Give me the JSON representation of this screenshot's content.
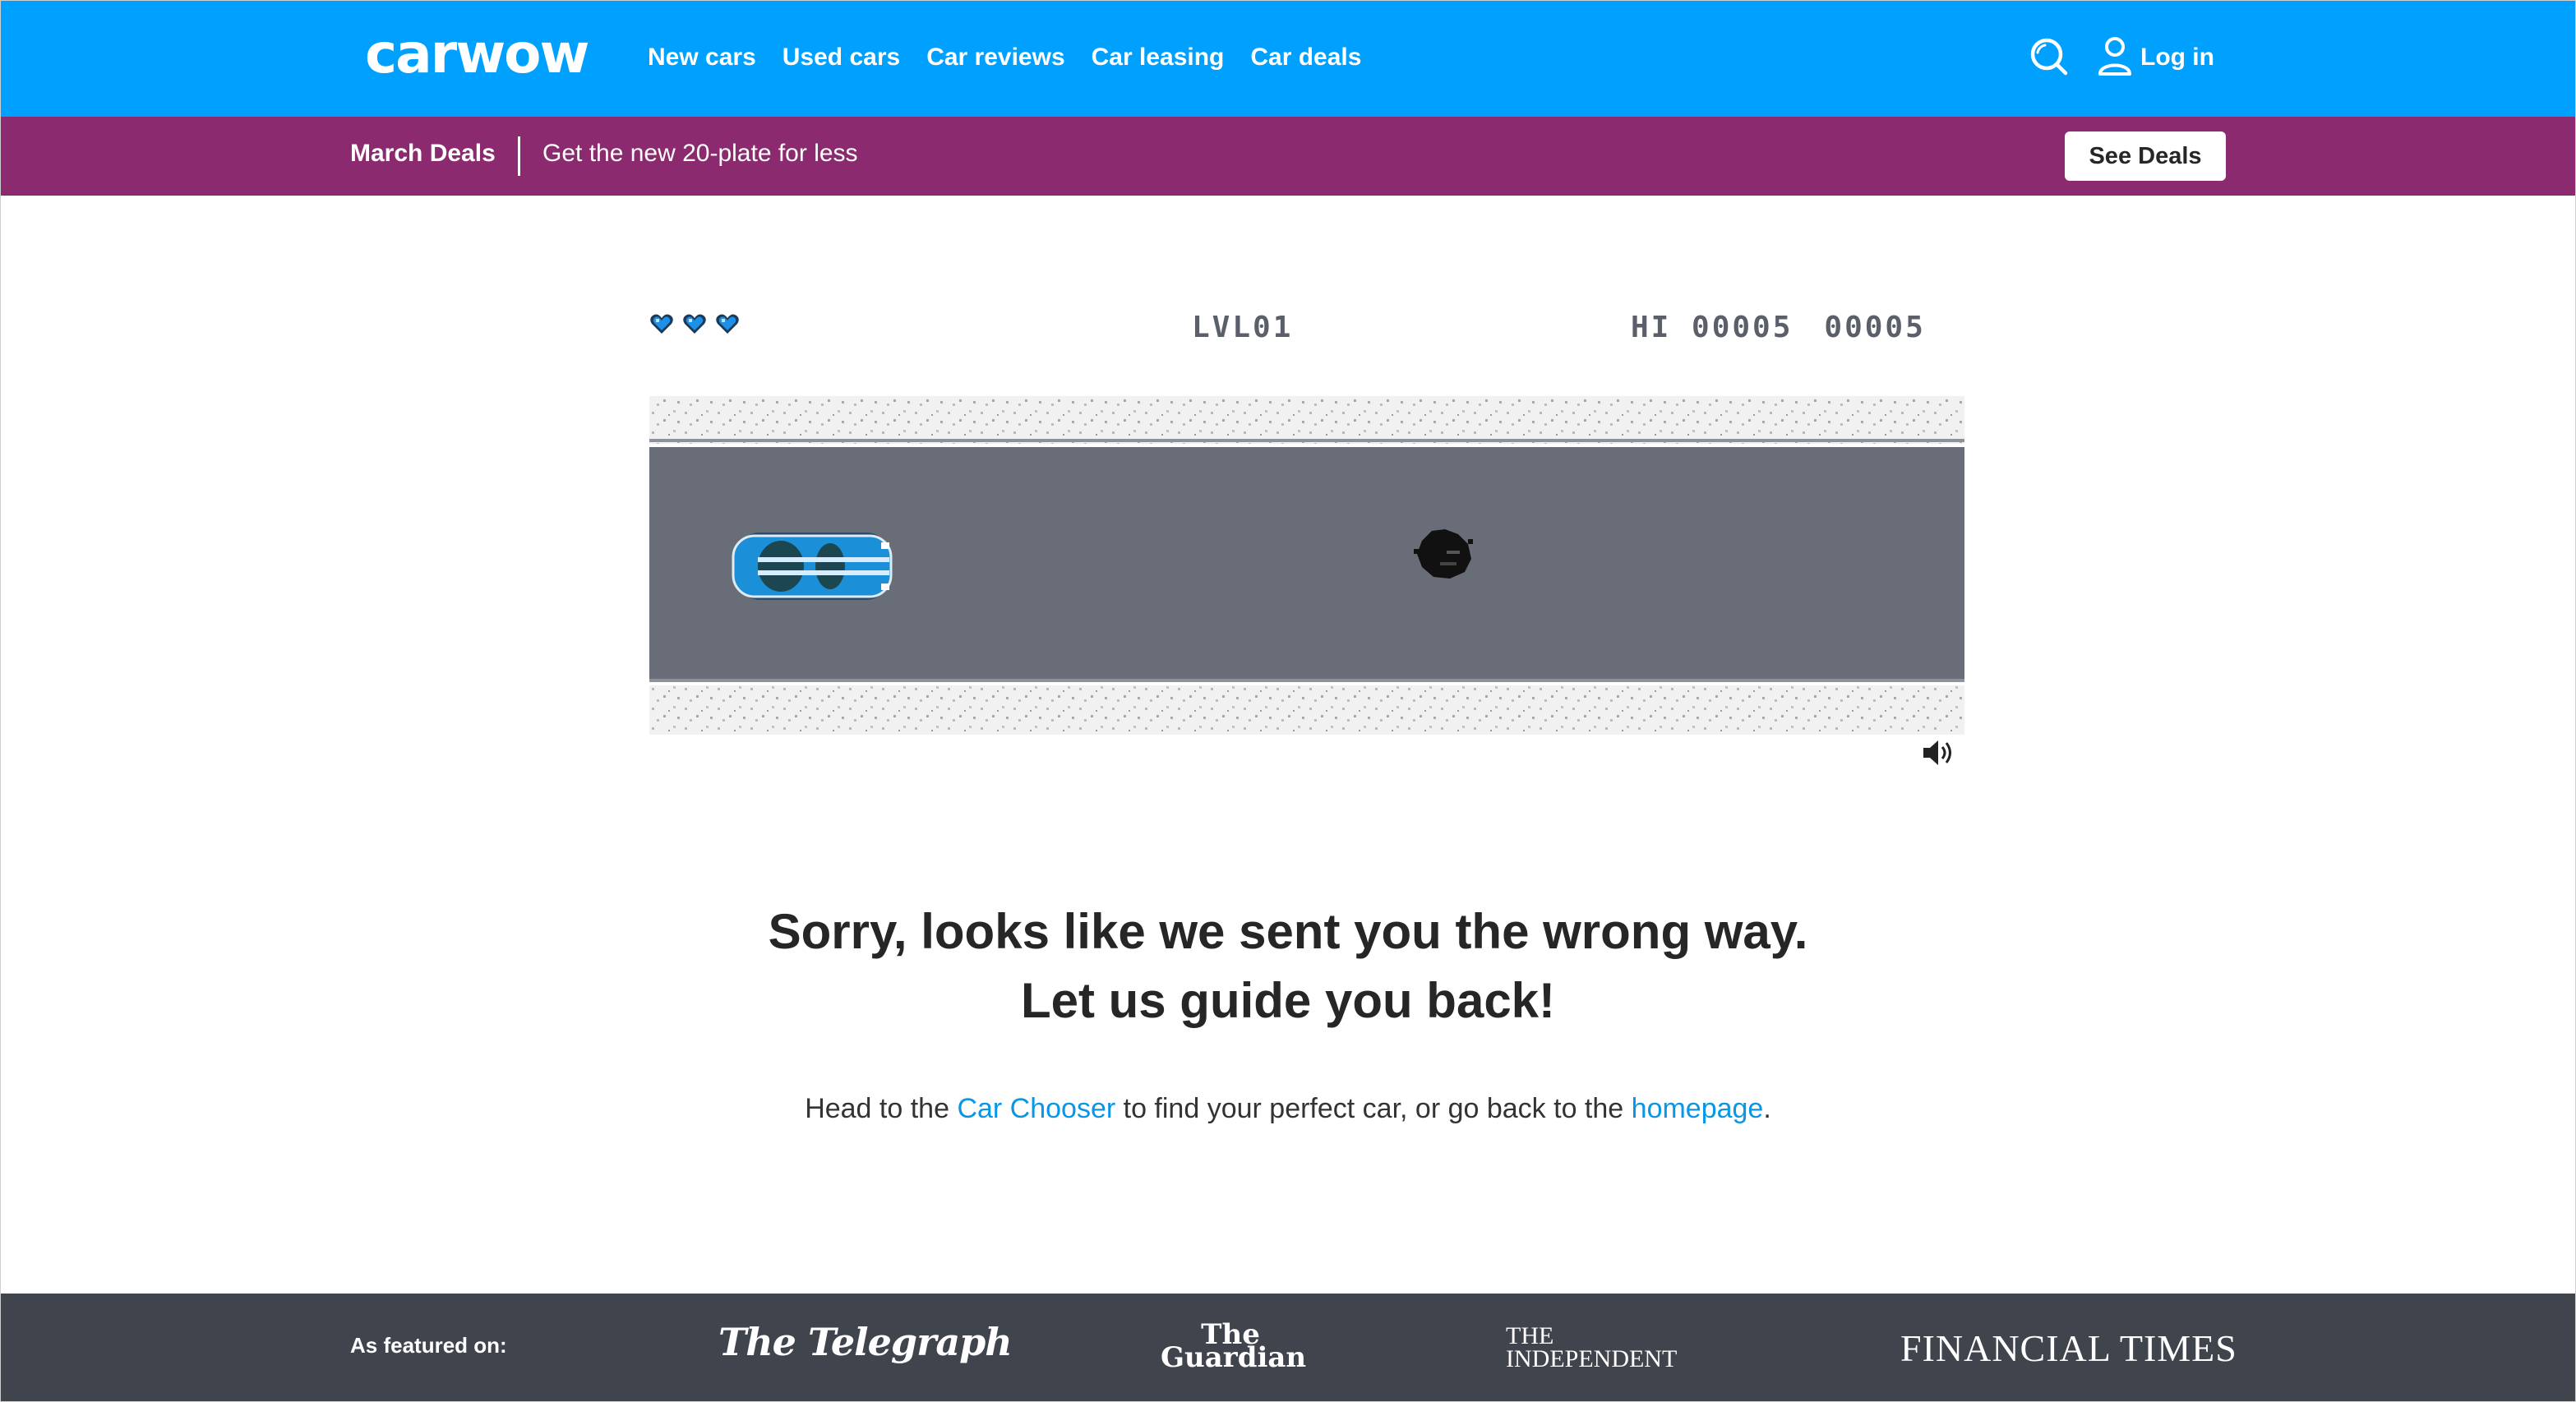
{
  "header": {
    "logo": "carwow",
    "nav": [
      "New cars",
      "Used cars",
      "Car reviews",
      "Car leasing",
      "Car deals"
    ],
    "login_label": "Log in",
    "search_icon": "search-icon",
    "user_icon": "user-icon"
  },
  "deals_bar": {
    "title": "March Deals",
    "text": "Get the new 20-plate for less",
    "button": "See Deals"
  },
  "game": {
    "lives": 3,
    "level": "LVL01",
    "hi_label": "HI 00005",
    "score": "00005",
    "sound_icon": "speaker-icon"
  },
  "message": {
    "line1": "Sorry, looks like we sent you the wrong way.",
    "line2": "Let us guide you back!",
    "body_prefix": "Head to the ",
    "link1": "Car Chooser",
    "body_middle": " to find your perfect car, or go back to the ",
    "link2": "homepage",
    "body_suffix": "."
  },
  "footer": {
    "featured_label": "As featured on:",
    "publications": [
      "The Telegraph",
      "The Guardian",
      "THE INDEPENDENT",
      "FINANCIAL TIMES"
    ]
  },
  "colors": {
    "brand_blue": "#00a0ff",
    "deals_purple": "#8b2a6e",
    "road_gray": "#696d77",
    "link_blue": "#0a96e6",
    "footer_bg": "#3f444d"
  }
}
